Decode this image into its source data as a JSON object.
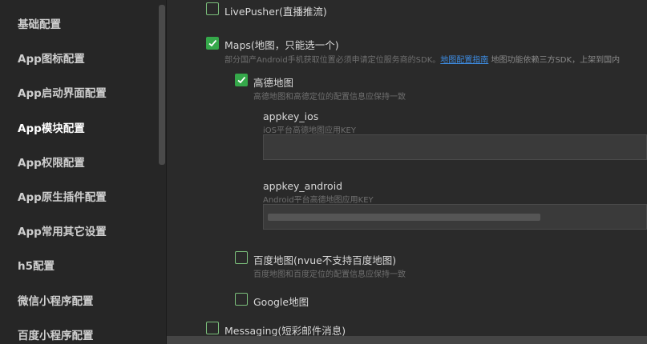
{
  "sidebar": {
    "items": [
      {
        "label": "基础配置"
      },
      {
        "label": "App图标配置"
      },
      {
        "label": "App启动界面配置"
      },
      {
        "label": "App模块配置"
      },
      {
        "label": "App权限配置"
      },
      {
        "label": "App原生插件配置"
      },
      {
        "label": "App常用其它设置"
      },
      {
        "label": "h5配置"
      },
      {
        "label": "微信小程序配置"
      },
      {
        "label": "百度小程序配置"
      }
    ],
    "active_index": 3
  },
  "main": {
    "livepusher": {
      "label": "LivePusher(直播推流)",
      "checked": false
    },
    "maps": {
      "label": "Maps(地图，只能选一个)",
      "checked": true,
      "desc_prefix": "部分国产Android手机获取位置必须申请定位服务商的SDK。",
      "desc_link": "地图配置指南",
      "desc_suffix": " 地图功能依赖三方SDK，上架到国内"
    },
    "gaode": {
      "label": "高德地图",
      "checked": true,
      "desc": "高德地图和高德定位的配置信息应保持一致",
      "appkey_ios": {
        "label": "appkey_ios",
        "desc": "iOS平台高德地图应用KEY",
        "value": ""
      },
      "appkey_android": {
        "label": "appkey_android",
        "desc": "Android平台高德地图应用KEY",
        "value": ""
      }
    },
    "baidu": {
      "label": "百度地图(nvue不支持百度地图)",
      "checked": false,
      "desc": "百度地图和百度定位的配置信息应保持一致"
    },
    "google": {
      "label": "Google地图",
      "checked": false
    },
    "messaging": {
      "label": "Messaging(短彩邮件消息)",
      "checked": false
    }
  },
  "colors": {
    "accent": "#35a84a",
    "link": "#3d8be0",
    "background": "#2a2a2a"
  }
}
